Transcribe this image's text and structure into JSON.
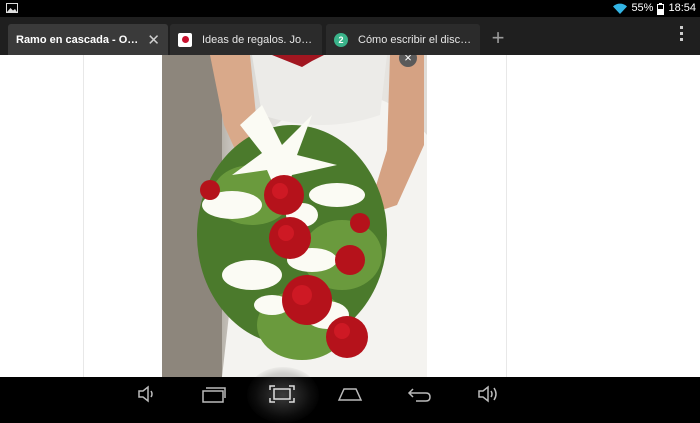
{
  "status": {
    "battery": "55%",
    "time": "18:54"
  },
  "tabs": [
    {
      "title": "Ramo en cascada - Orga…",
      "favicon": "none"
    },
    {
      "title": "Ideas de regalos. Joyas…",
      "favicon": "japan-flag"
    },
    {
      "title": "Cómo escribir el discurs…",
      "favicon": "2"
    }
  ],
  "colors": {
    "rose": "#b5121b",
    "tab_bar": "#1f1f1f",
    "page_bg": "#ffffff"
  },
  "icons": [
    "image-icon",
    "wifi-icon",
    "battery-icon",
    "close-icon",
    "new-tab-icon",
    "overflow-menu-icon",
    "volume-down-icon",
    "recent-apps-icon",
    "screenshot-icon",
    "home-icon",
    "back-icon",
    "volume-up-icon"
  ]
}
